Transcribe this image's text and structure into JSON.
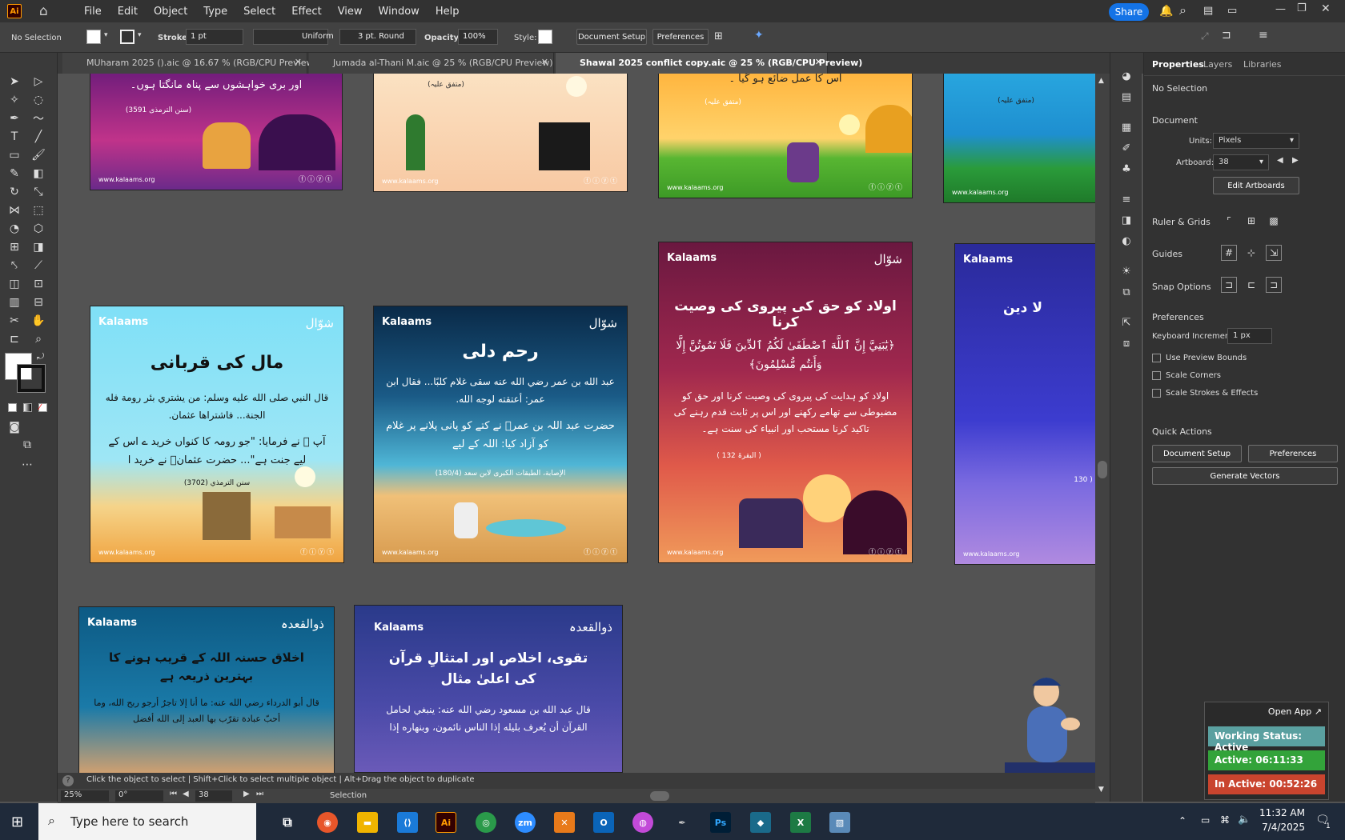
{
  "menubar": {
    "logo": "Ai",
    "items": [
      "File",
      "Edit",
      "Object",
      "Type",
      "Select",
      "Effect",
      "View",
      "Window",
      "Help"
    ],
    "share": "Share"
  },
  "control": {
    "selection": "No Selection",
    "stroke_label": "Stroke:",
    "stroke_value": "1 pt",
    "uniform": "Uniform",
    "brush": "3 pt. Round",
    "opacity_label": "Opacity:",
    "opacity_value": "100%",
    "style_label": "Style:",
    "doc_setup": "Document Setup",
    "preferences": "Preferences"
  },
  "tabs": [
    {
      "label": "MUharam 2025 ().aic @ 16.67 % (RGB/CPU Preview)"
    },
    {
      "label": "Jumada al-Thani M.aic @ 25 % (RGB/CPU Preview)"
    },
    {
      "label": "Shawal 2025 conflict copy.aic @ 25 % (RGB/CPU Preview)"
    }
  ],
  "cards": {
    "c1_text": "اور بری خواہشوں سے پناہ مانگتا ہوں۔",
    "c1_ref": "(سنن الترمذی 3591)",
    "url": "www.kalaams.org",
    "c2_ref": "(متفق علیہ)",
    "c3_text": "اس کا عمل ضائع ہو گیا ۔",
    "c3_ref": "(متفق علیہ)",
    "logo": "Kalaams",
    "shawwal": "شوّال",
    "wealth_title": "مال کی قربانی",
    "wealth_body": "قال النبي صلى الله عليه وسلم: من يشتري بئر رومة فله الجنة... فاشتراها عثمان.",
    "wealth_body2": "آپ ﷺ نے فرمایا: \"جو رومہ کا کنواں خرید ے اس کے لیے جنت ہے\"... حضرت عثمانؓ نے خرید ا",
    "wealth_ref": "سنن الترمذي (3702)",
    "mercy_title": "رحم دلی",
    "mercy_body": "عبد الله بن عمر رضي الله عنه سقى غلام كلبًا... فقال ابن عمر: أعتقته لوجه الله.",
    "mercy_body2": "حضرت عبد اللہ بن عمرؓ نے کتے کو پانی پلانے پر غلام کو آزاد کیا: اللہ کے لیے",
    "mercy_ref": "الإصابة، الطبقات الكبرى لابن سعد (180/4)",
    "children_title": "اولاد کو حق کی پیروی کی وصیت کرنا",
    "children_ayah": "﴿يَٰبَنِيَّ إِنَّ ٱللَّهَ ٱصْطَفَىٰ لَكُمُ ٱلدِّينَ فَلَا تَمُوتُنَّ إِلَّا وَأَنتُم مُّسْلِمُونَ﴾",
    "children_body": "اولاد کو ہدایت کی پیروی کی وصیت کرنا اور حق کو مضبوطی سے تھامے رکھنے اور اس پر ثابت قدم رہنے کی تاکید کرنا مستحب اور انبیاء کی سنت ہے۔",
    "children_ref": "( البقرۃ 132 )",
    "c8_title": "لا دین",
    "c8_ref": "( 130",
    "dhul": "ذوالقعدہ",
    "akhlaq_title": "اخلاق حسنہ اللہ کے قریب ہونے کا بہترین ذریعہ ہے",
    "akhlaq_body": "قال أبو الدرداء رضي الله عنه: ما أنا إلا تاجرٌ أرجو ربح الله، وما أحبّ عبادة تقرّب بها العبد إلى الله أفضل",
    "taqwa_title": "تقوی، اخلاص اور امتثالِ قرآن کی اعلیٰ مثال",
    "taqwa_body": "قال عبد الله بن مسعود رضي الله عنه: ينبغي لحامل القرآن أن يُعرف بليله إذا الناس نائمون، وبنهاره إذا"
  },
  "panel": {
    "tabs": [
      "Properties",
      "Layers",
      "Libraries"
    ],
    "no_selection": "No Selection",
    "document": "Document",
    "units_label": "Units:",
    "units_value": "Pixels",
    "artboard_label": "Artboard:",
    "artboard_value": "38",
    "edit_artboards": "Edit Artboards",
    "ruler_grids": "Ruler & Grids",
    "guides": "Guides",
    "snap": "Snap Options",
    "preferences_title": "Preferences",
    "kb_label": "Keyboard Increment:",
    "kb_value": "1 px",
    "chk1": "Use Preview Bounds",
    "chk2": "Scale Corners",
    "chk3": "Scale Strokes & Effects",
    "quick": "Quick Actions",
    "doc_setup": "Document Setup",
    "prefs": "Preferences",
    "gen_vectors": "Generate Vectors"
  },
  "status": {
    "hint": "Click the object to select  |  Shift+Click to select multiple object  |  Alt+Drag the object to duplicate",
    "zoom": "25%",
    "angle": "0°",
    "artboard": "38",
    "tool": "Selection"
  },
  "widget": {
    "open_app": "Open App ↗",
    "working": "Working Status: Active",
    "active": "Active: 06:11:33",
    "inactive": "In Active: 00:52:26",
    "colors": {
      "working": "#5aa0a0",
      "active": "#33a33a",
      "inactive": "#c9442e"
    }
  },
  "taskbar": {
    "search": "Type here to search",
    "time": "11:32 AM",
    "date": "7/4/2025",
    "notif": "1"
  }
}
